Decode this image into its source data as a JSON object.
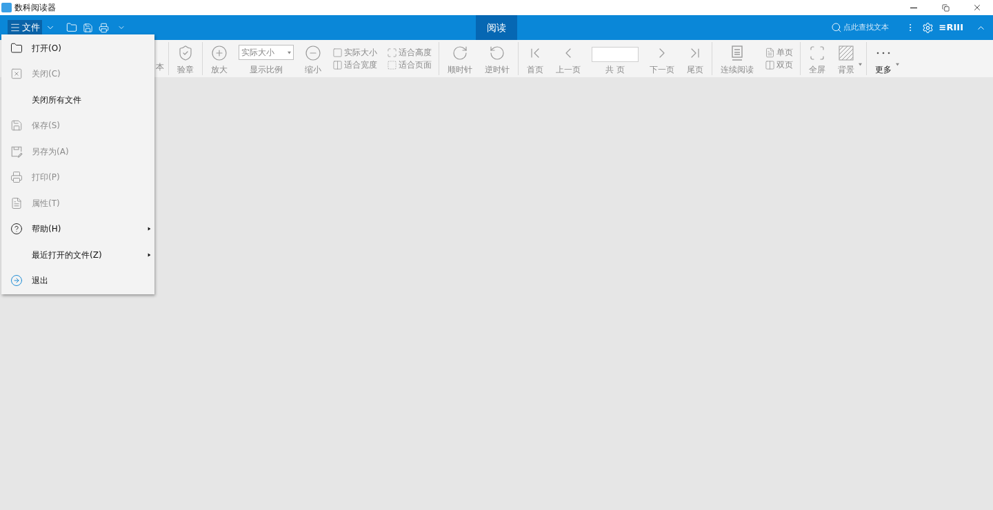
{
  "window": {
    "title": "数科阅读器"
  },
  "ribbon": {
    "menu_button": {
      "label": "文件",
      "selected": true
    },
    "tabs": [
      {
        "label": "阅读",
        "selected": true
      }
    ],
    "search": {
      "placeholder": "点此查找文本"
    },
    "account": "≡RIII"
  },
  "toolbar": {
    "groups": [
      [
        {
          "kind": "clipped",
          "label": "本",
          "disabled": true
        }
      ],
      [
        {
          "kind": "button",
          "label": "验章",
          "disabled": true,
          "dropdown": false
        }
      ],
      [
        {
          "kind": "button",
          "label": "放大",
          "disabled": true,
          "dropdown": false
        },
        {
          "kind": "select",
          "value": "实际大小",
          "label": "显示比例"
        },
        {
          "kind": "button",
          "label": "缩小",
          "disabled": true,
          "dropdown": false
        },
        {
          "kind": "pair",
          "options": [
            {
              "label": "实际大小",
              "disabled": true
            },
            {
              "label": "适合宽度",
              "disabled": true
            }
          ]
        },
        {
          "kind": "pair",
          "options": [
            {
              "label": "适合高度",
              "disabled": true
            },
            {
              "label": "适合页面",
              "disabled": true
            }
          ]
        }
      ],
      [
        {
          "kind": "button",
          "label": "顺时针",
          "disabled": true,
          "dropdown": false
        },
        {
          "kind": "button",
          "label": "逆时针",
          "disabled": true,
          "dropdown": false
        }
      ],
      [
        {
          "kind": "button",
          "label": "首页",
          "disabled": true,
          "dropdown": false
        },
        {
          "kind": "button",
          "label": "上一页",
          "disabled": true,
          "dropdown": false
        },
        {
          "kind": "page_input",
          "label": "共 页"
        },
        {
          "kind": "button",
          "label": "下一页",
          "disabled": true,
          "dropdown": false
        },
        {
          "kind": "button",
          "label": "尾页",
          "disabled": true,
          "dropdown": false
        }
      ],
      [
        {
          "kind": "button",
          "label": "连续阅读",
          "disabled": true,
          "dropdown": false
        },
        {
          "kind": "pair",
          "options": [
            {
              "label": "单页",
              "disabled": true
            },
            {
              "label": "双页",
              "disabled": true
            }
          ]
        }
      ],
      [
        {
          "kind": "button",
          "label": "全屏",
          "disabled": true,
          "dropdown": false
        },
        {
          "kind": "button",
          "label": "背景",
          "disabled": true,
          "dropdown": true
        }
      ],
      [
        {
          "kind": "button",
          "label": "更多",
          "disabled": false,
          "dropdown": true
        }
      ]
    ]
  },
  "file_menu": {
    "items": [
      {
        "label": "打开(O)",
        "disabled": false,
        "submenu": false
      },
      {
        "label": "关闭(C)",
        "disabled": true,
        "submenu": false
      },
      {
        "label": "关闭所有文件",
        "disabled": false,
        "submenu": false
      },
      {
        "label": "保存(S)",
        "disabled": true,
        "submenu": false
      },
      {
        "label": "另存为(A)",
        "disabled": true,
        "submenu": false
      },
      {
        "label": "打印(P)",
        "disabled": true,
        "submenu": false
      },
      {
        "label": "属性(T)",
        "disabled": true,
        "submenu": false
      },
      {
        "label": "帮助(H)",
        "disabled": false,
        "submenu": true
      },
      {
        "label": "最近打开的文件(Z)",
        "disabled": false,
        "submenu": true
      },
      {
        "label": "退出",
        "disabled": false,
        "submenu": false
      }
    ]
  }
}
